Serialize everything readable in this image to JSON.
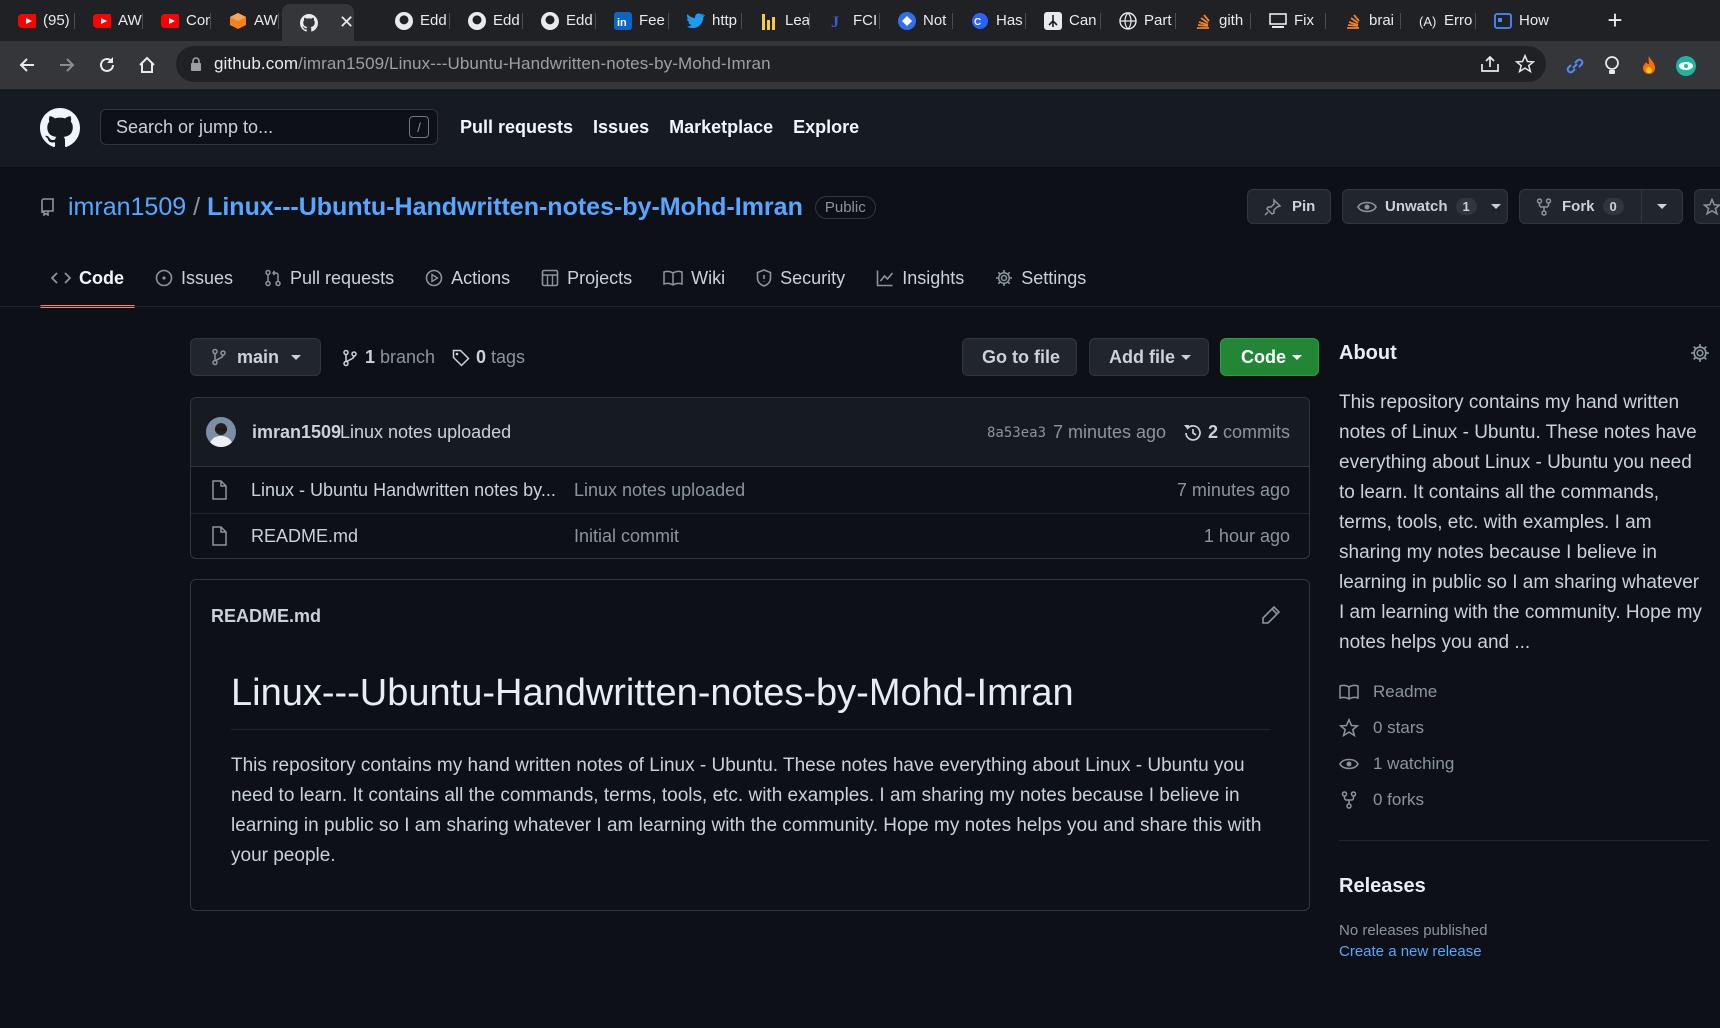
{
  "browser": {
    "tabs": [
      {
        "label": "(95)",
        "icon": "youtube-icon"
      },
      {
        "label": "AW",
        "icon": "youtube-icon"
      },
      {
        "label": "Con",
        "icon": "youtube-icon"
      },
      {
        "label": "AW",
        "icon": "aws-icon"
      },
      {
        "label": "",
        "icon": "github-icon",
        "active": true
      },
      {
        "label": "Edd",
        "icon": "github-icon"
      },
      {
        "label": "Edd",
        "icon": "github-icon"
      },
      {
        "label": "Edd",
        "icon": "github-icon"
      },
      {
        "label": "Fee",
        "icon": "linkedin-icon"
      },
      {
        "label": "http",
        "icon": "twitter-icon"
      },
      {
        "label": "Lea",
        "icon": "bar-chart-icon"
      },
      {
        "label": "FCI",
        "icon": "f-letter-icon"
      },
      {
        "label": "Not",
        "icon": "diamond-icon"
      },
      {
        "label": "Has",
        "icon": "hashnode-icon"
      },
      {
        "label": "Can",
        "icon": "peace-icon"
      },
      {
        "label": "Part",
        "icon": "web-icon"
      },
      {
        "label": "gith",
        "icon": "stack-icon"
      },
      {
        "label": "Fix",
        "icon": "monitor-icon"
      },
      {
        "label": "brai",
        "icon": "stack-icon"
      },
      {
        "label": "Erro",
        "icon": "a-circle-icon"
      },
      {
        "label": "How",
        "icon": "window-icon"
      }
    ],
    "url_host": "github.com",
    "url_path": "/imran1509/Linux---Ubuntu-Handwritten-notes-by-Mohd-Imran"
  },
  "header": {
    "search_placeholder": "Search or jump to...",
    "slash_key": "/",
    "nav": [
      "Pull requests",
      "Issues",
      "Marketplace",
      "Explore"
    ]
  },
  "repo": {
    "owner": "imran1509",
    "name": "Linux---Ubuntu-Handwritten-notes-by-Mohd-Imran",
    "visibility": "Public",
    "pin_label": "Pin",
    "unwatch_label": "Unwatch",
    "watch_count": "1",
    "fork_label": "Fork",
    "fork_count": "0"
  },
  "tabs": [
    {
      "label": "Code",
      "icon": "code-icon",
      "active": true
    },
    {
      "label": "Issues",
      "icon": "issue-icon"
    },
    {
      "label": "Pull requests",
      "icon": "pull-request-icon"
    },
    {
      "label": "Actions",
      "icon": "play-icon"
    },
    {
      "label": "Projects",
      "icon": "table-icon"
    },
    {
      "label": "Wiki",
      "icon": "book-icon"
    },
    {
      "label": "Security",
      "icon": "shield-icon"
    },
    {
      "label": "Insights",
      "icon": "graph-icon"
    },
    {
      "label": "Settings",
      "icon": "gear-icon"
    }
  ],
  "filenav": {
    "branch": "main",
    "branch_count": "1",
    "branch_word": "branch",
    "tag_count": "0",
    "tag_word": "tags",
    "go_to_file": "Go to file",
    "add_file": "Add file",
    "code": "Code"
  },
  "commit": {
    "author": "imran1509",
    "message": "Linux notes uploaded",
    "sha": "8a53ea3",
    "time": "7 minutes ago",
    "count": "2",
    "count_word": "commits"
  },
  "files": [
    {
      "name": "Linux - Ubuntu Handwritten notes by...",
      "message": "Linux notes uploaded",
      "time": "7 minutes ago"
    },
    {
      "name": "README.md",
      "message": "Initial commit",
      "time": "1 hour ago"
    }
  ],
  "readme": {
    "filename": "README.md",
    "heading": "Linux---Ubuntu-Handwritten-notes-by-Mohd-Imran",
    "body": "This repository contains my hand written notes of Linux - Ubuntu. These notes have everything about Linux - Ubuntu you need to learn. It contains all the commands, terms, tools, etc. with examples. I am sharing my notes because I believe in learning in public so I am sharing whatever I am learning with the community. Hope my notes helps you and share this with your people."
  },
  "about": {
    "title": "About",
    "description": "This repository contains my hand written notes of Linux - Ubuntu. These notes have everything about Linux - Ubuntu you need to learn. It contains all the commands, terms, tools, etc. with examples. I am sharing my notes because I believe in learning in public so I am sharing whatever I am learning with the community. Hope my notes helps you and ...",
    "items": [
      {
        "label": "Readme",
        "icon": "book-icon"
      },
      {
        "label": "0 stars",
        "icon": "star-icon"
      },
      {
        "label": "1 watching",
        "icon": "eye-icon"
      },
      {
        "label": "0 forks",
        "icon": "fork-icon"
      }
    ]
  },
  "releases": {
    "title": "Releases",
    "none": "No releases published",
    "create_link": "Create a new release"
  },
  "colors": {
    "bg": "#0d1117",
    "header_bg": "#161b22",
    "link": "#58a6ff",
    "green_button": "#238636",
    "tab_underline": "#f78166"
  }
}
